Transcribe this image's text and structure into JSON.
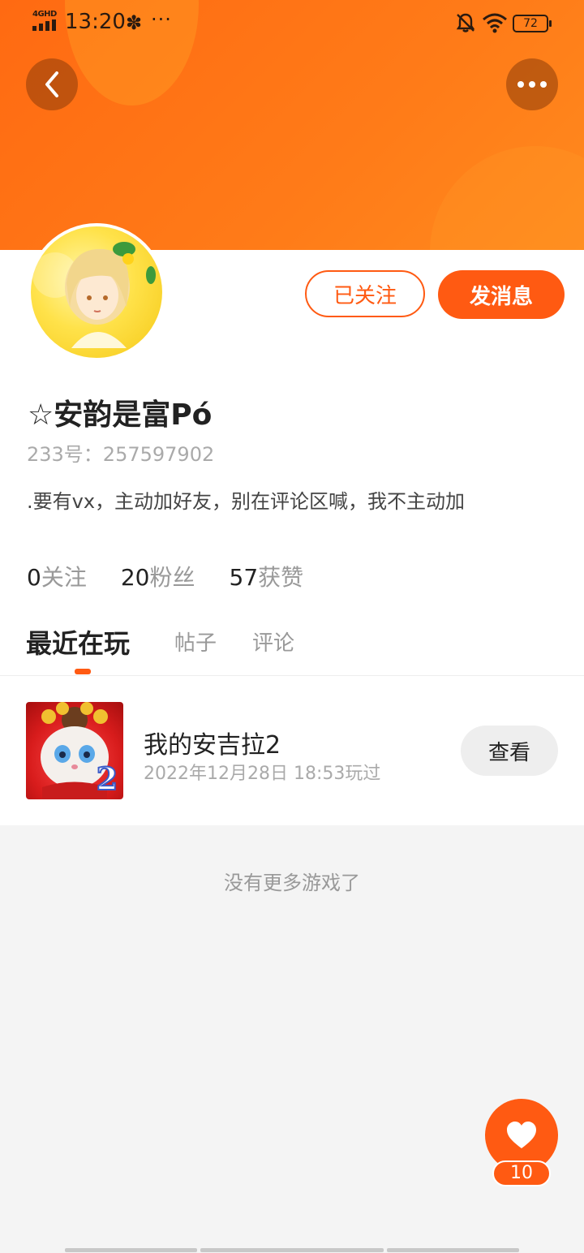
{
  "status_bar": {
    "network": "4GHD",
    "time": "13:20",
    "app_icon": "✽",
    "more": "···",
    "battery": "72"
  },
  "header": {
    "back_icon": "chevron-left-icon",
    "more_icon": "more-dots-icon"
  },
  "profile": {
    "follow_label": "已关注",
    "message_label": "发消息",
    "nickname": "☆安韵是富Pó",
    "uid": "233号：257597902",
    "bio": ".要有vx，主动加好友，别在评论区喊，我不主动加",
    "stats": [
      {
        "num": "0",
        "label": "关注"
      },
      {
        "num": "20",
        "label": "粉丝"
      },
      {
        "num": "57",
        "label": "获赞"
      }
    ]
  },
  "tabs": [
    {
      "label": "最近在玩",
      "active": true
    },
    {
      "label": "帖子",
      "active": false
    },
    {
      "label": "评论",
      "active": false
    }
  ],
  "games": [
    {
      "name": "我的安吉拉2",
      "played_at": "2022年12月28日 18:53玩过",
      "view_label": "查看",
      "badge": "2"
    }
  ],
  "empty_text": "没有更多游戏了",
  "like": {
    "icon": "heart-icon",
    "count": "10"
  },
  "colors": {
    "accent": "#ff5a12",
    "header_gradient_start": "#ff6a12",
    "header_gradient_end": "#ff8a1e"
  }
}
